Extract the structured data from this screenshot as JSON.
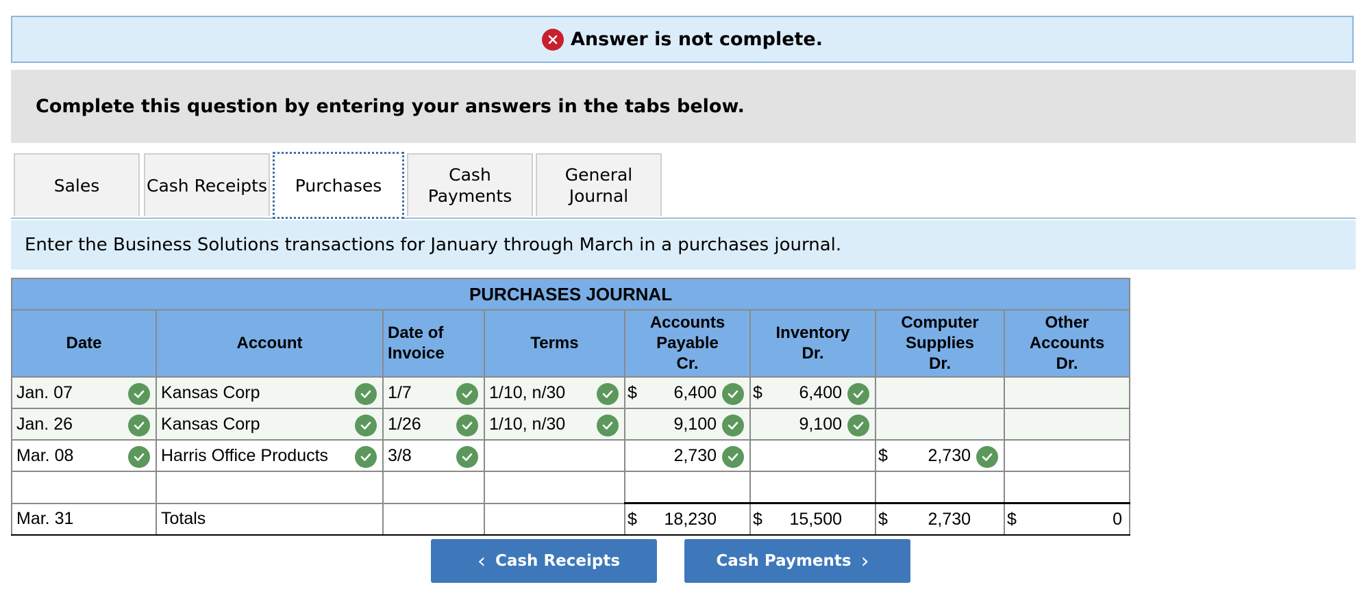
{
  "alert": {
    "text": "Answer is not complete."
  },
  "instructions": "Complete this question by entering your answers in the tabs below.",
  "tabs": [
    {
      "label": "Sales"
    },
    {
      "label": "Cash Receipts"
    },
    {
      "label": "Purchases"
    },
    {
      "label": "Cash\nPayments"
    },
    {
      "label": "General\nJournal"
    }
  ],
  "active_tab": "Purchases",
  "description": "Enter the Business Solutions transactions for January through March in a purchases journal.",
  "journal": {
    "title": "PURCHASES JOURNAL",
    "headers": {
      "date": "Date",
      "account": "Account",
      "date_of_invoice": "Date of\nInvoice",
      "terms": "Terms",
      "ap": "Accounts\nPayable\nCr.",
      "inventory": "Inventory\nDr.",
      "computer": "Computer\nSupplies\nDr.",
      "other": "Other\nAccounts\nDr."
    },
    "rows": [
      {
        "date": "Jan. 07",
        "account": "Kansas Corp",
        "invoice": "1/7",
        "terms": "1/10, n/30",
        "ap_dollar": "$",
        "ap": "6,400",
        "inv_dollar": "$",
        "inv": "6,400"
      },
      {
        "date": "Jan. 26",
        "account": "Kansas Corp",
        "invoice": "1/26",
        "terms": "1/10, n/30",
        "ap": "9,100",
        "inv": "9,100"
      },
      {
        "date": "Mar. 08",
        "account": "Harris Office Products",
        "invoice": "3/8",
        "ap": "2,730",
        "cs_dollar": "$",
        "cs": "2,730"
      }
    ],
    "totals": {
      "date": "Mar. 31",
      "label": "Totals",
      "ap_dollar": "$",
      "ap": "18,230",
      "inv_dollar": "$",
      "inv": "15,500",
      "cs_dollar": "$",
      "cs": "2,730",
      "other_dollar": "$",
      "other": "0"
    }
  },
  "nav": {
    "prev": "Cash Receipts",
    "next": "Cash Payments"
  },
  "colors": {
    "header_blue": "#7aaee6",
    "button_blue": "#3e78bb",
    "check_green": "#5c985c",
    "error_red": "#c8202d",
    "info_blue": "#dbedf9"
  }
}
